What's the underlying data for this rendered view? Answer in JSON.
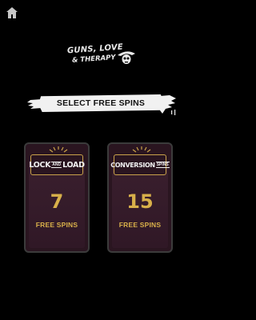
{
  "logo": {
    "title": "GUNS, LOVE",
    "subtitle": "& THERAPY"
  },
  "banner": {
    "text": "SELECT FREE SPINS"
  },
  "options": [
    {
      "name_part1": "LOCK",
      "name_part2": "AND",
      "name_part3": "LOAD",
      "count": "7",
      "unit": "FREE SPINS"
    },
    {
      "name_part1": "CONVERSION",
      "name_suffix": "SPINS",
      "count": "15",
      "unit": "FREE SPINS"
    }
  ],
  "colors": {
    "background": "#000000",
    "card_bg": "#2a1520",
    "card_border": "#3b3b3b",
    "gold": "#d8b04a",
    "banner_bg": "#f1f1f1"
  },
  "icons": {
    "home": "home-icon",
    "logo_art": "skull-sombrero-icon"
  }
}
